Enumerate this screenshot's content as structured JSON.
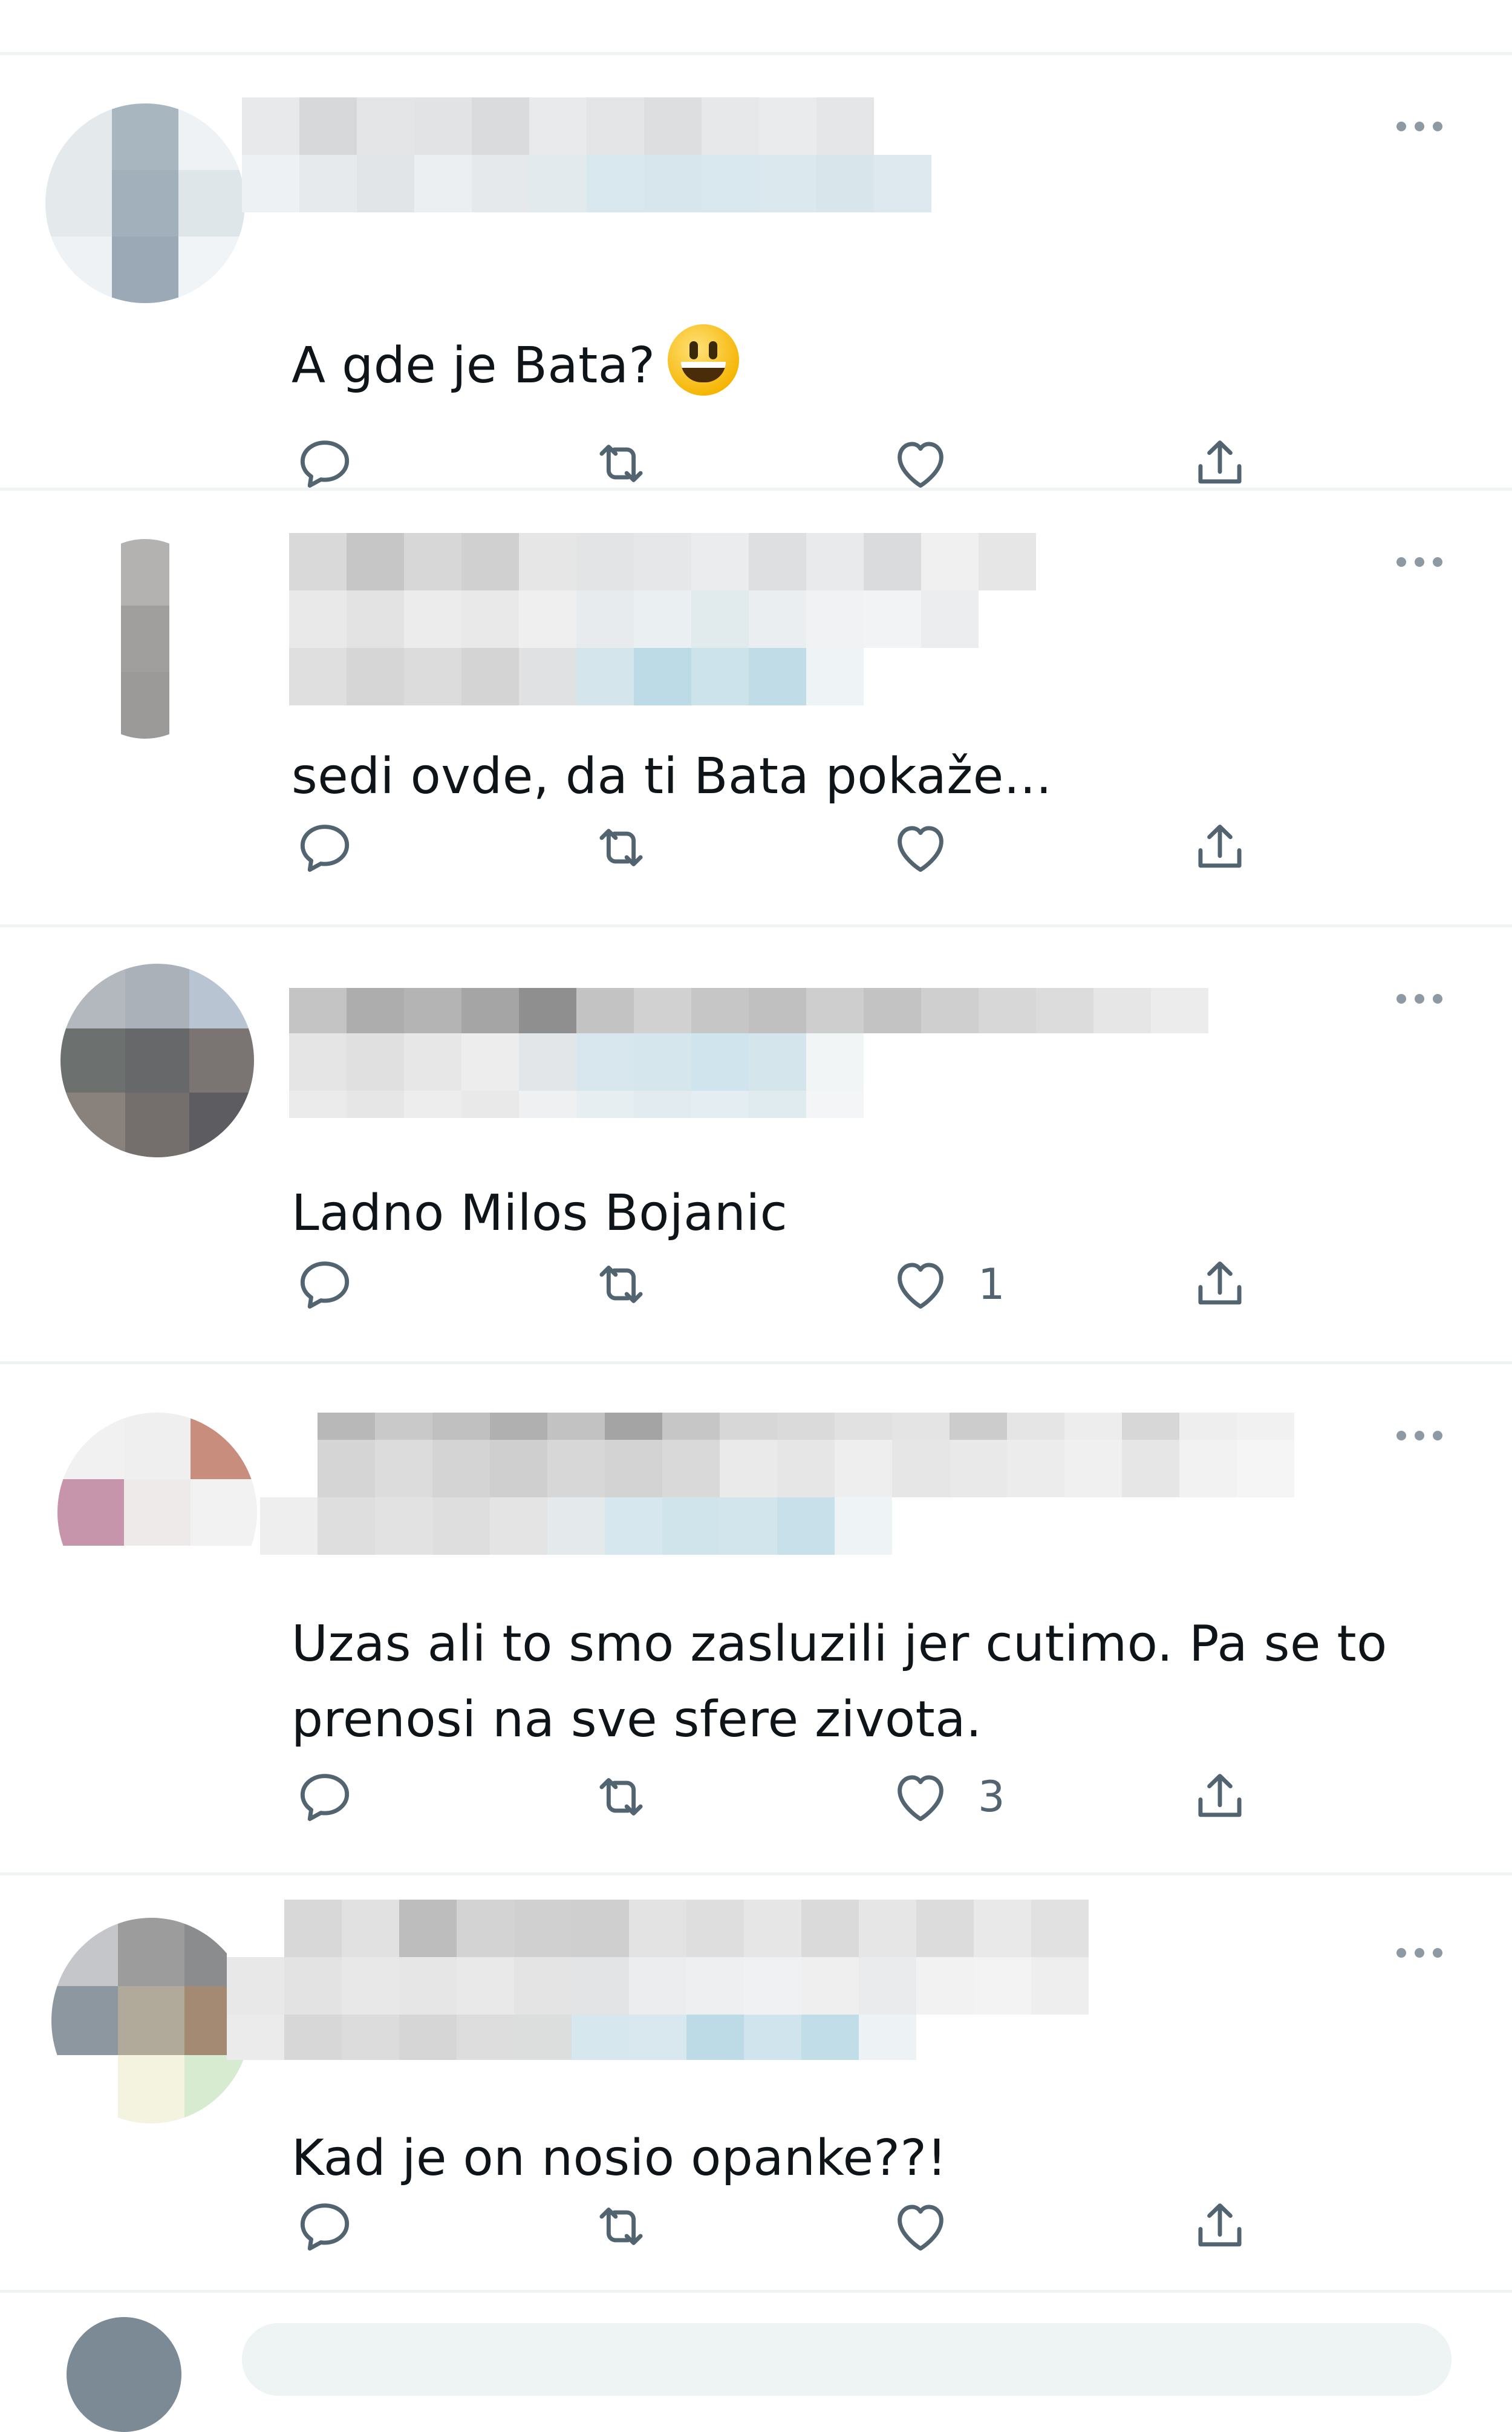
{
  "tweets": [
    {
      "text": "A gde je Bata?",
      "emoji": "grinning-face-emoji",
      "likes": ""
    },
    {
      "text": "sedi ovde, da ti Bata pokaže...",
      "likes": ""
    },
    {
      "text": "Ladno Milos Bojanic",
      "likes": "1"
    },
    {
      "text": "Uzas ali to smo zasluzili jer cutimo. Pa se to prenosi na sve sfere zivota.",
      "likes": "3"
    },
    {
      "text": "Kad je on nosio opanke??!",
      "likes": ""
    }
  ],
  "icons": {
    "reply": "reply-icon",
    "retweet": "retweet-icon",
    "like": "heart-icon",
    "share": "share-icon",
    "more": "more-options-icon"
  },
  "colors": {
    "icon_gray": "#536471",
    "divider": "#eff3f4",
    "text": "#0f1419"
  }
}
